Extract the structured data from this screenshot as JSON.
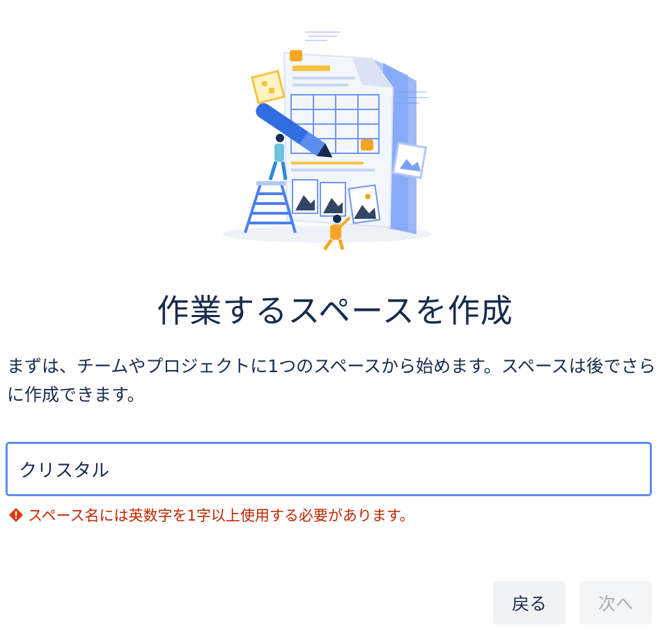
{
  "page": {
    "title": "作業するスペースを作成",
    "description": "まずは、チームやプロジェクトに1つのスペースから始めます。スペースは後でさらに作成できます。"
  },
  "space_name_input": {
    "value": "クリスタル"
  },
  "error": {
    "icon": "error-icon",
    "message": "スペース名には英数字を1字以上使用する必要があります。"
  },
  "buttons": {
    "back_label": "戻る",
    "next_label": "次へ"
  },
  "colors": {
    "input_focus_border": "#5b8def",
    "error": "#bf2600",
    "heading": "#172b4d"
  }
}
